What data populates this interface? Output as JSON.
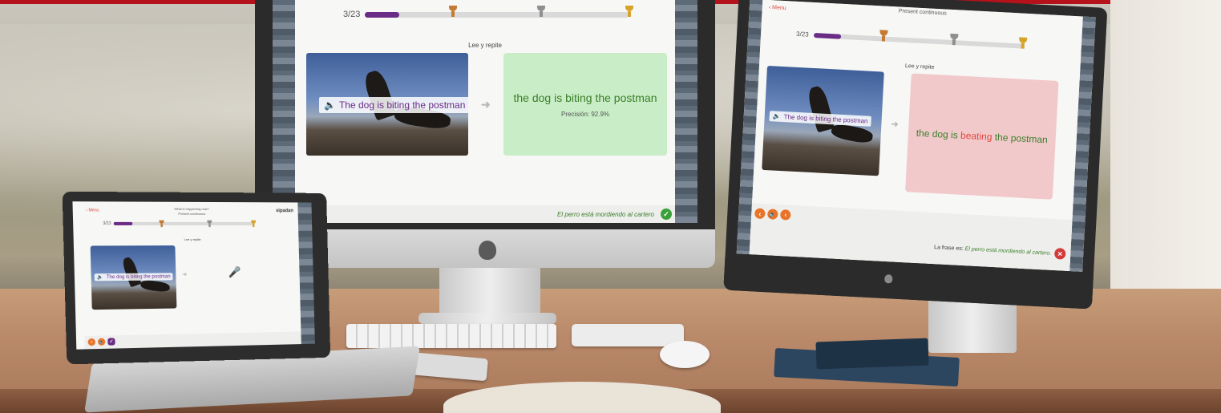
{
  "center_screen": {
    "progress_count": "3/23",
    "progress_fraction": 0.13,
    "instruction": "Lee y repite",
    "caption": "The dog is biting the postman",
    "result_sentence": "the dog is biting the postman",
    "precision": "Precisión: 92.9%",
    "footer_feedback": "El perro está mordiendo al cartero"
  },
  "right_screen": {
    "back_label": "Menu",
    "lesson_title": "Present continuous",
    "progress_count": "3/23",
    "progress_fraction": 0.13,
    "instruction": "Lee y repite",
    "caption": "The dog is biting the postman",
    "result_start": "the dog is",
    "result_wrong": "beating",
    "result_end": "the postman",
    "feedback_prefix": "La frase es:",
    "feedback_sentence": "El perro está mordiendo al cartero."
  },
  "laptop_screen": {
    "back_label": "Menu",
    "lesson_title": "What is happening now?",
    "lesson_subtitle": "Present continuous",
    "logo": "sipadan",
    "progress_count": "3/23",
    "progress_fraction": 0.13,
    "instruction": "Lee y repite",
    "caption": "The dog is biting the postman"
  },
  "icons": {
    "speaker": "🔈",
    "arrow": "➜",
    "back": "‹",
    "check": "✓",
    "close": "✕",
    "microphone": "🎤"
  },
  "colors": {
    "brand_purple": "#6a2c86",
    "accent_orange": "#e8742a",
    "correct_green": "#3b7f2a",
    "error_red": "#e0463c",
    "correct_bg": "#c9edc6",
    "error_bg": "#f2c9cb"
  }
}
